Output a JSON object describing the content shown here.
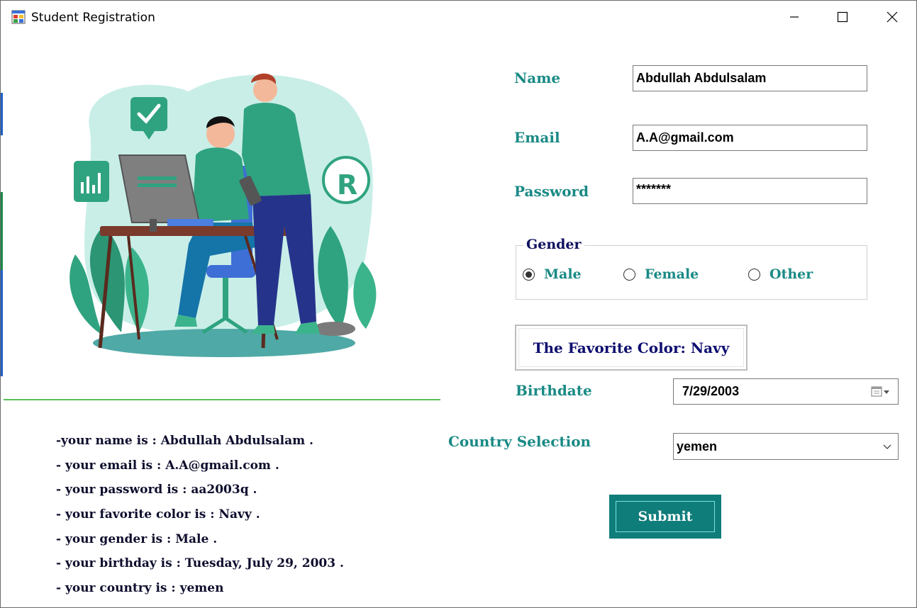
{
  "window": {
    "title": "Student Registration",
    "controls": [
      "minimize",
      "maximize",
      "close"
    ]
  },
  "form": {
    "name_label": "Name",
    "name_value": "Abdullah Abdulsalam",
    "email_label": "Email",
    "email_value": "A.A@gmail.com",
    "password_label": "Password",
    "password_value": "*******",
    "gender": {
      "title": "Gender",
      "options": [
        {
          "label": "Male",
          "checked": true
        },
        {
          "label": "Female",
          "checked": false
        },
        {
          "label": "Other",
          "checked": false
        }
      ]
    },
    "favorite_color_button": "The Favorite Color: Navy",
    "birthdate_label": "Birthdate",
    "birthdate_value": "7/29/2003",
    "country_label": "Country Selection",
    "country_value": "yemen",
    "submit_label": "Submit"
  },
  "summary": [
    "-your name is : Abdullah Abdulsalam .",
    "- your email is : A.A@gmail.com .",
    "- your password is : aa2003q .",
    "- your favorite color is : Navy .",
    "- your gender is : Male .",
    "- your birthday is : Tuesday, July 29, 2003 .",
    "- your country is : yemen"
  ],
  "colors": {
    "label_teal": "#1a8a85",
    "navy_text": "#0d0d70",
    "submit_bg": "#0f7d7a",
    "divider_green": "#5ac05a",
    "illustration_bg": "#c9eee8",
    "illustration_green": "#2fa37f"
  },
  "icons": [
    "app-icon",
    "minimize-icon",
    "maximize-icon",
    "close-icon",
    "calendar-icon",
    "chevron-down-icon"
  ]
}
